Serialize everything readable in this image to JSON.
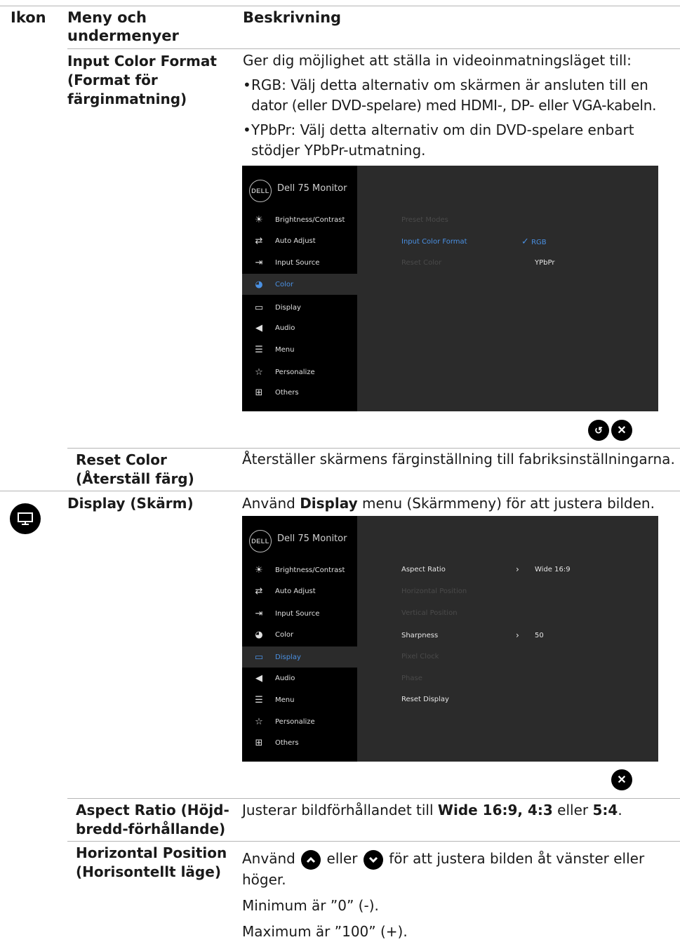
{
  "header": {
    "col_icon": "Ikon",
    "col_menu_line1": "Meny och",
    "col_menu_line2": "undermenyer",
    "col_desc": "Beskrivning"
  },
  "rows": {
    "input_color": {
      "name_line1": "Input Color Format",
      "name_line2": "(Format för",
      "name_line3": "färginmatning)",
      "intro": "Ger dig möjlighet att ställa in videoinmatningsläget till:",
      "bullet1_term": "RGB:",
      "bullet1_line1": " Välj detta alternativ om skärmen är ansluten till en",
      "bullet1_line2": "dator (eller DVD-spelare) med HDMI-, DP- eller VGA-kabeln.",
      "bullet2_term": "YPbPr:",
      "bullet2_line1": " Välj detta alternativ om din DVD-spelare enbart",
      "bullet2_line2": "stödjer YPbPr-utmatning."
    },
    "reset_color": {
      "name_line1": "Reset Color",
      "name_line2": "(Återställ färg)",
      "desc": "Återställer skärmens färginställning till fabriksinställningarna."
    },
    "display": {
      "name": "Display (Skärm)",
      "desc_pre": "Använd ",
      "desc_bold": "Display",
      "desc_post": " menu (Skärmmeny) för att justera bilden."
    },
    "aspect_ratio": {
      "name_line1": "Aspect Ratio (Höjd-",
      "name_line2": "bredd-förhållande)",
      "desc_pre": "Justerar bildförhållandet till ",
      "desc_bold1": "Wide 16:9, 4:3",
      "desc_mid": " eller ",
      "desc_bold2": "5:4",
      "desc_post": "."
    },
    "horizontal_position": {
      "name_line1": "Horizontal Position",
      "name_line2": "(Horisontellt läge)",
      "desc_pre": "Använd",
      "desc_mid": "eller",
      "desc_post": "för att justera bilden åt vänster eller",
      "desc_line2": "höger.",
      "min": "Minimum är ”0” (-).",
      "max": "Maximum är ”100” (+)."
    }
  },
  "osd": {
    "logo": "DELL",
    "title": "Dell 75 Monitor",
    "menu": [
      "Brightness/Contrast",
      "Auto Adjust",
      "Input Source",
      "Color",
      "Display",
      "Audio",
      "Menu",
      "Personalize",
      "Others"
    ],
    "color_panel": {
      "sub": [
        "Preset Modes",
        "Input Color Format",
        "Reset Color"
      ],
      "opt_rgb": "RGB",
      "opt_ypbpr": "YPbPr"
    },
    "display_panel": {
      "sub": [
        "Aspect Ratio",
        "Horizontal Position",
        "Vertical Position",
        "Sharpness",
        "Pixel Clock",
        "Phase",
        "Reset Display"
      ],
      "aspect_value": "Wide 16:9",
      "sharpness_value": "50"
    }
  },
  "colors": {
    "accent": "#4a90e2",
    "osd_bg": "#2b2b2b",
    "osd_nav": "#000000"
  },
  "icons": [
    "brightness-icon",
    "auto-adjust-icon",
    "input-source-icon",
    "color-icon",
    "display-icon",
    "audio-icon",
    "menu-icon",
    "personalize-icon",
    "others-icon",
    "back-icon",
    "close-icon",
    "up-arrow-icon",
    "down-arrow-icon"
  ]
}
